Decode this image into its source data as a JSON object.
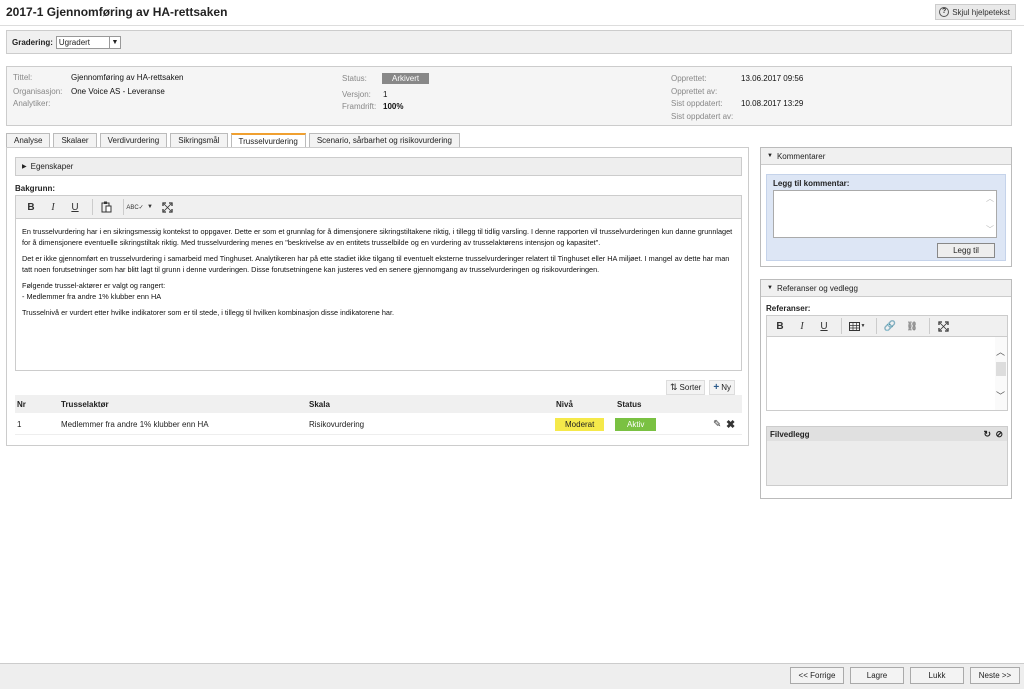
{
  "header": {
    "title": "2017-1 Gjennomføring av HA-rettsaken",
    "help_label": "Skjul hjelpetekst"
  },
  "grading": {
    "label": "Gradering:",
    "value": "Ugradert"
  },
  "meta": {
    "tittel_label": "Tittel:",
    "tittel_value": "Gjennomføring av HA-rettsaken",
    "org_label": "Organisasjon:",
    "org_value": "One Voice AS - Leveranse",
    "analytiker_label": "Analytiker:",
    "status_label": "Status:",
    "status_value": "Arkivert",
    "versjon_label": "Versjon:",
    "versjon_value": "1",
    "framdrift_label": "Framdrift:",
    "framdrift_value": "100%",
    "opprettet_label": "Opprettet:",
    "opprettet_value": "13.06.2017 09:56",
    "opprettet_av_label": "Opprettet av:",
    "sist_oppdatert_label": "Sist oppdatert:",
    "sist_oppdatert_value": "10.08.2017 13:29",
    "sist_oppdatert_av_label": "Sist oppdatert av:"
  },
  "tabs": [
    {
      "label": "Analyse"
    },
    {
      "label": "Skalaer"
    },
    {
      "label": "Verdivurdering"
    },
    {
      "label": "Sikringsmål"
    },
    {
      "label": "Trusselvurdering"
    },
    {
      "label": "Scenario, sårbarhet og risikovurdering"
    }
  ],
  "properties_label": "Egenskaper",
  "background_label": "Bakgrunn:",
  "editor": {
    "p1": "En trusselvurdering har i en sikringsmessig kontekst to oppgaver. Dette er som et grunnlag for å dimensjonere sikringstiltakene riktig, i tillegg til tidlig varsling. I denne rapporten vil trusselvurderingen kun danne grunnlaget for å dimensjonere eventuelle sikringstiltak riktig. Med trusselvurdering menes en \"beskrivelse av en entitets trusselbilde og en vurdering av trusselaktørens intensjon og kapasitet\".",
    "p2": "Det er ikke gjennomført en trusselvurdering i samarbeid med Tinghuset. Analytikeren har på ette stadiet ikke tilgang til eventuelt eksterne trusselvurderinger relatert til Tinghuset eller HA miljøet. I mangel av dette har man tatt noen forutsetninger som har blitt lagt til grunn i denne vurderingen. Disse forutsetningene kan justeres ved en senere gjennomgang av trusselvurderingen og risikovurderingen.",
    "p3a": "Følgende trussel-aktører er valgt og rangert:",
    "p3b": "- Medlemmer fra andre 1% klubber enn HA",
    "p4": "Trusselnivå er vurdert etter hvilke indikatorer som er til stede, i tillegg til hvilken kombinasjon disse indikatorene har."
  },
  "list_tools": {
    "sort_label": "Sorter",
    "new_label": "Ny"
  },
  "table": {
    "headers": [
      "Nr",
      "Trusselaktør",
      "Skala",
      "Nivå",
      "Status"
    ],
    "rows": [
      {
        "nr": "1",
        "aktor": "Medlemmer fra andre 1% klubber enn HA",
        "skala": "Risikovurdering",
        "niva": "Moderat",
        "status": "Aktiv"
      }
    ]
  },
  "comments": {
    "title": "Kommentarer",
    "add_label": "Legg til kommentar:",
    "button": "Legg til"
  },
  "references": {
    "title": "Referanser og vedlegg",
    "ref_label": "Referanser:",
    "file_label": "Filvedlegg"
  },
  "footer": {
    "prev": "<< Forrige",
    "save": "Lagre",
    "close": "Lukk",
    "next": "Neste >>"
  },
  "colors": {
    "active_tab": "#f0a030",
    "moderat": "#f5e94a",
    "aktiv": "#7ac142",
    "status_badge": "#888888"
  }
}
